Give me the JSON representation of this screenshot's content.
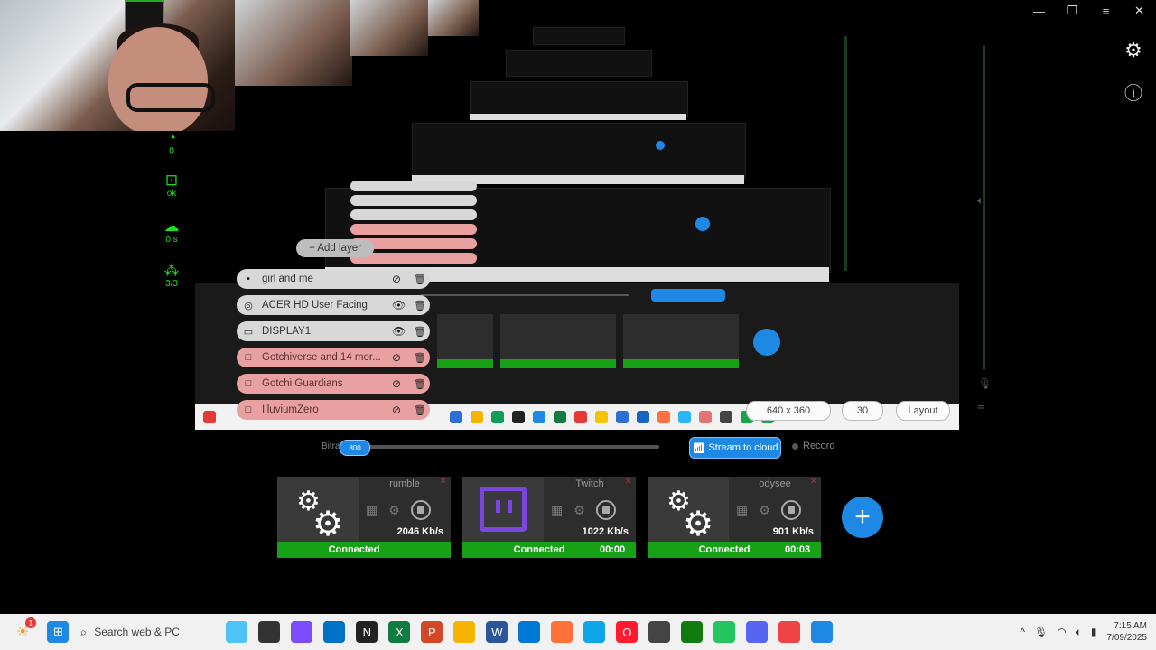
{
  "window": {
    "minimize": "—",
    "restore": "❐",
    "menu": "≡",
    "close": "✕"
  },
  "status": [
    {
      "icon": "clock-icon",
      "glyph": "◔",
      "value": "0"
    },
    {
      "icon": "cpu-icon",
      "glyph": "⊡",
      "value": "ok"
    },
    {
      "icon": "cloud-icon",
      "glyph": "☁",
      "value": "0.s"
    },
    {
      "icon": "network-icon",
      "glyph": "⁂",
      "value": "3/3"
    }
  ],
  "layers_panel": {
    "add_label": "+ Add layer",
    "layers": [
      {
        "name": "girl and me",
        "icon": "image-icon",
        "glyph": "▪",
        "state": "hidden-eye",
        "style": "normal"
      },
      {
        "name": "ACER HD User Facing",
        "icon": "camera-icon",
        "glyph": "◎",
        "state": "eye",
        "style": "normal"
      },
      {
        "name": "DISPLAY1",
        "icon": "monitor-icon",
        "glyph": "▭",
        "state": "eye",
        "style": "normal"
      },
      {
        "name": "Gotchiverse and 14 mor...",
        "icon": "window-icon",
        "glyph": "□",
        "state": "hidden-eye",
        "style": "hidden"
      },
      {
        "name": "Gotchi Guardians",
        "icon": "window-icon",
        "glyph": "□",
        "state": "hidden-eye",
        "style": "hidden"
      },
      {
        "name": "IlluviumZero",
        "icon": "window-icon",
        "glyph": "□",
        "state": "hidden-eye",
        "style": "hidden"
      }
    ]
  },
  "preview_strip": {
    "resolution": "640 x 360",
    "fps": "30",
    "layout": "Layout"
  },
  "bitrate": {
    "label": "Bitra",
    "knob": "800",
    "fill_percent": 8
  },
  "actions": {
    "stream": "Stream to cloud",
    "record": "Record"
  },
  "destinations": [
    {
      "title": "rumble",
      "rate": "2046 Kb/s",
      "status": "Connected",
      "time": "",
      "thumb": "gears"
    },
    {
      "title": "Twitch",
      "rate": "1022 Kb/s",
      "status": "Connected",
      "time": "00:00",
      "thumb": "twitch"
    },
    {
      "title": "odysee",
      "rate": "901 Kb/s",
      "status": "Connected",
      "time": "00:03",
      "thumb": "gears"
    }
  ],
  "add_destination": "+",
  "taskbar": {
    "search_placeholder": "Search web & PC",
    "time": "7:15 AM",
    "date": "7/09/2025",
    "notify_badge": "1"
  },
  "colors": {
    "accent": "#1e88e5",
    "connected": "#17a117",
    "twitch": "#7b45e0",
    "layer_hidden": "#e9a0a0"
  }
}
